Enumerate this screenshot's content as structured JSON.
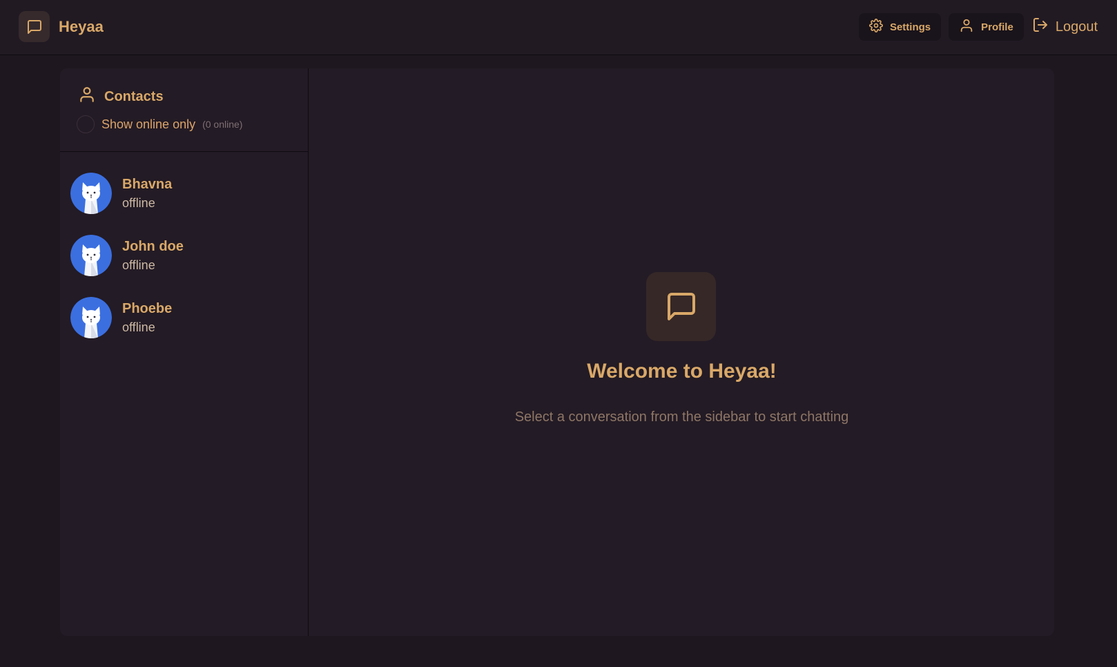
{
  "app": {
    "name": "Heyaa"
  },
  "nav": {
    "settings": "Settings",
    "profile": "Profile",
    "logout": "Logout"
  },
  "sidebar": {
    "title": "Contacts",
    "filter_label": "Show online only",
    "online_count": "(0 online)",
    "contacts": [
      {
        "name": "Bhavna",
        "status": "offline"
      },
      {
        "name": "John doe",
        "status": "offline"
      },
      {
        "name": "Phoebe",
        "status": "offline"
      }
    ]
  },
  "main": {
    "welcome_title": "Welcome to Heyaa!",
    "welcome_subtitle": "Select a conversation from the sidebar to start chatting"
  },
  "icons": {
    "brand": "message-square-icon",
    "settings": "gear-icon",
    "profile": "user-icon",
    "logout": "logout-icon",
    "contacts": "user-icon",
    "avatar": "cat-avatar"
  },
  "colors": {
    "accent": "#d9a868",
    "background": "#1e1720",
    "panel": "#231b25",
    "avatar_bg": "#3b6fe0"
  }
}
